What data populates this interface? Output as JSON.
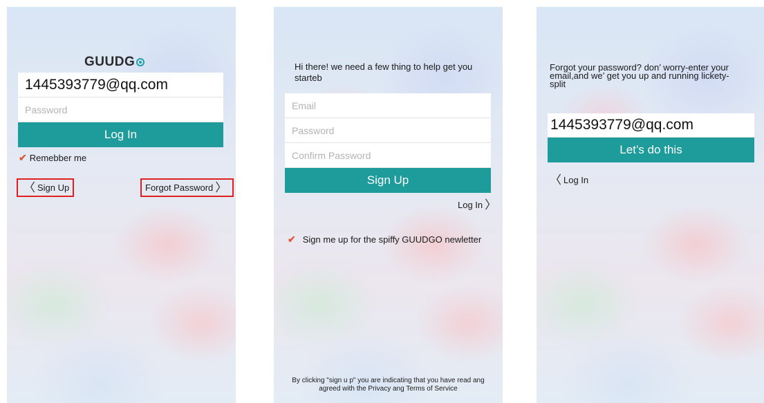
{
  "colors": {
    "accent": "#1e9b9b",
    "check": "#e05a3a",
    "highlight_box": "#e02020"
  },
  "login": {
    "logo": "GUUDG",
    "email_value": "1445393779@qq.com",
    "password_placeholder": "Password",
    "login_button": "Log In",
    "remember_label": "Remebber me",
    "remember_checked": true,
    "signup_link": "Sign Up",
    "forgot_link": "Forgot Password"
  },
  "signup": {
    "intro": "Hi there! we need a few thing to help get you starteb",
    "email_placeholder": "Email",
    "password_placeholder": "Password",
    "confirm_placeholder": "Confirm Password",
    "signup_button": "Sign Up",
    "login_link": "Log In",
    "newsletter_label": "Sign me up for the spiffy GUUDGO newletter",
    "newsletter_checked": true,
    "terms_line1": "By clicking \"sign u p\" you are indicating that you have read ang",
    "terms_line2": "agreed with the Privacy ang Terms of Service"
  },
  "forgot": {
    "intro_line1": "Forgot your password? don’ worry-enter your",
    "intro_line2": "email,and we’ get you up and running lickety-",
    "intro_line3": "split",
    "email_value": "1445393779@qq.com",
    "submit_button": "Let’s do this",
    "login_link": "Log In"
  }
}
